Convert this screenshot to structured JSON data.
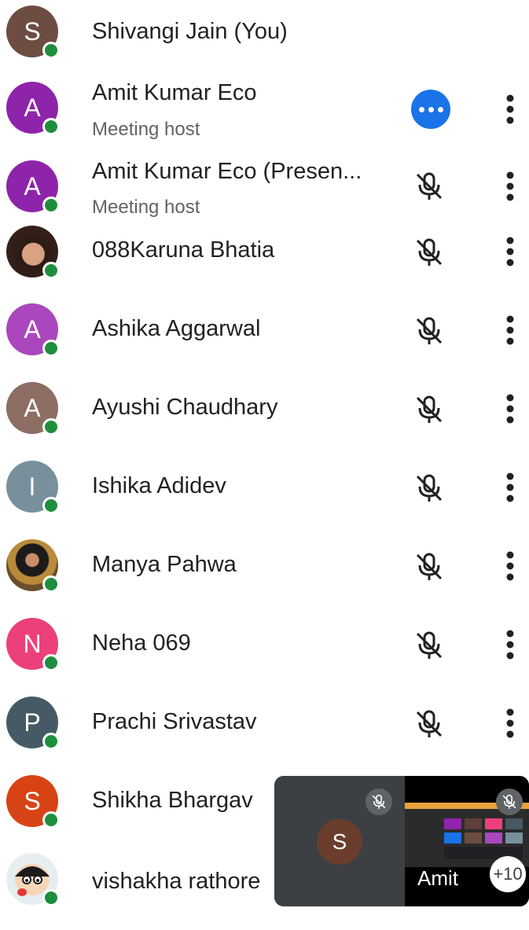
{
  "participants": [
    {
      "initial": "S",
      "name": "Shivangi Jain (You)",
      "sub": "",
      "color": "#6d4c41"
    },
    {
      "initial": "A",
      "name": "Amit Kumar Eco",
      "sub": "Meeting host",
      "color": "#8e24aa"
    },
    {
      "initial": "A",
      "name": "Amit Kumar Eco (Presen...",
      "sub": "Meeting host",
      "color": "#8e24aa"
    },
    {
      "initial": "",
      "name": "088Karuna Bhatia",
      "sub": "",
      "color": "#3e2723"
    },
    {
      "initial": "A",
      "name": "Ashika Aggarwal",
      "sub": "",
      "color": "#ab47bc"
    },
    {
      "initial": "A",
      "name": "Ayushi Chaudhary",
      "sub": "",
      "color": "#8d6e63"
    },
    {
      "initial": "I",
      "name": "Ishika Adidev",
      "sub": "",
      "color": "#78909c"
    },
    {
      "initial": "",
      "name": "Manya Pahwa",
      "sub": "",
      "color": "#8a6d3b"
    },
    {
      "initial": "N",
      "name": "Neha 069",
      "sub": "",
      "color": "#ec407a"
    },
    {
      "initial": "P",
      "name": "Prachi Srivastav",
      "sub": "",
      "color": "#455a64"
    },
    {
      "initial": "S",
      "name": "Shikha Bhargav",
      "sub": "",
      "color": "#d84315"
    },
    {
      "initial": "",
      "name": "vishakha rathore",
      "sub": "",
      "color": "#cfd8dc"
    }
  ],
  "pip": {
    "self_initial": "S",
    "presenter_label": "Amit",
    "more_count": "+10"
  },
  "colors": {
    "online": "#1e8e3e",
    "host_badge": "#1a73e8"
  }
}
